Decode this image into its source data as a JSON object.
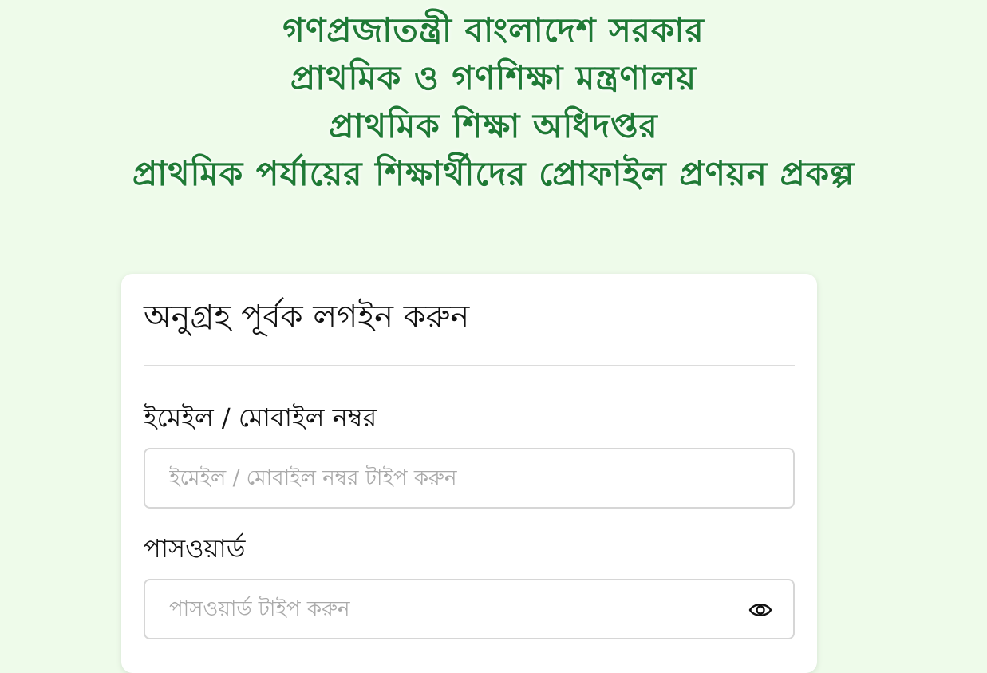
{
  "header": {
    "line1": "গণপ্রজাতন্ত্রী বাংলাদেশ সরকার",
    "line2": "প্রাথমিক ও গণশিক্ষা মন্ত্রণালয়",
    "line3": "প্রাথমিক শিক্ষা অধিদপ্তর",
    "line4": "প্রাথমিক পর্যায়ের শিক্ষার্থীদের প্রোফাইল প্রণয়ন প্রকল্প"
  },
  "login": {
    "title": "অনুগ্রহ পূর্বক লগইন করুন",
    "email_label": "ইমেইল / মোবাইল নম্বর",
    "email_placeholder": "ইমেইল / মোবাইল নম্বর টাইপ করুন",
    "email_value": "",
    "password_label": "পাসওয়ার্ড",
    "password_placeholder": "পাসওয়ার্ড টাইপ করুন",
    "password_value": "",
    "password_toggle_icon": "eye-icon"
  },
  "colors": {
    "background": "#eefbea",
    "header_text": "#1f7a35",
    "card_background": "#ffffff",
    "input_border": "#d6d6d6",
    "placeholder": "#a9a9a9"
  }
}
